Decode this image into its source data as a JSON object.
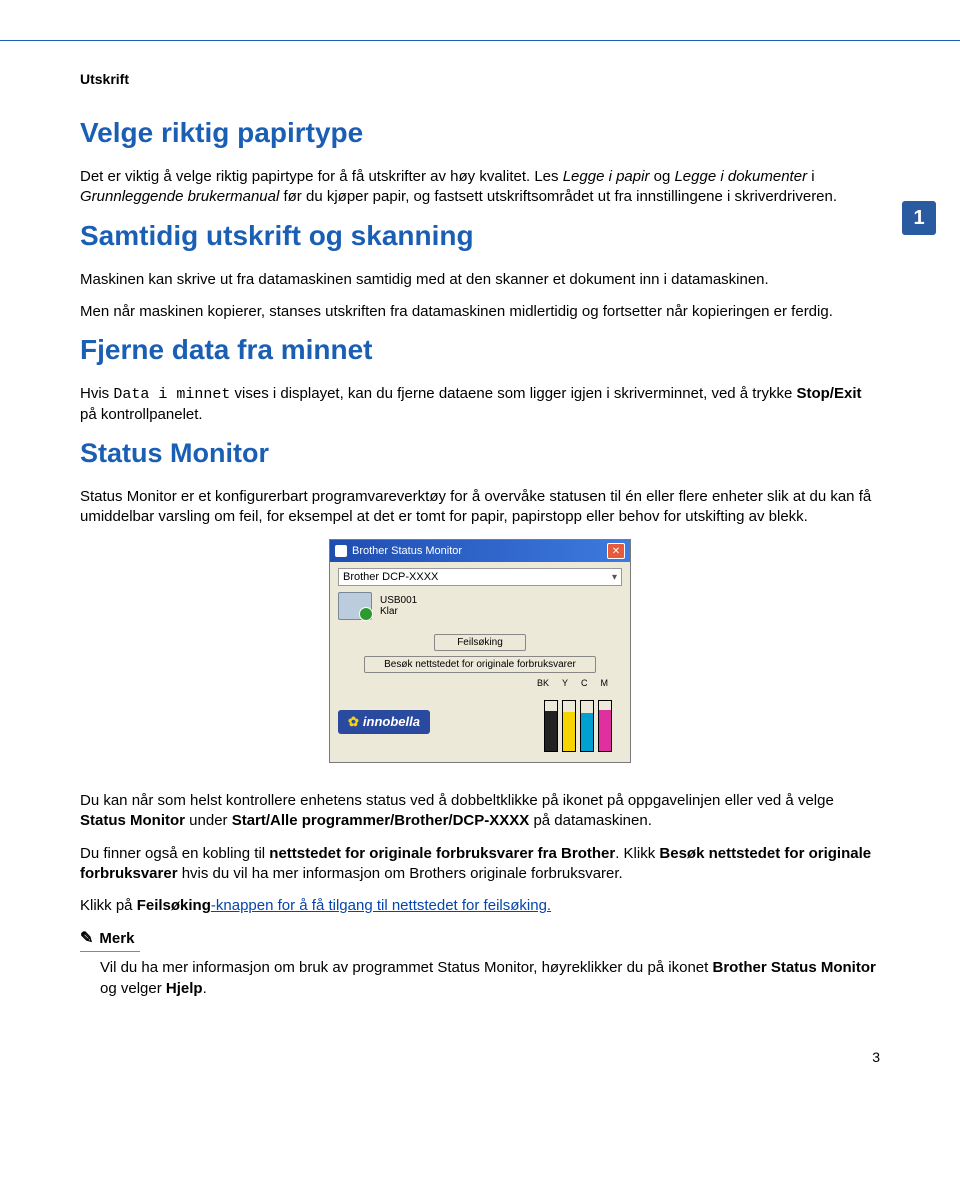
{
  "chapter_label": "Utskrift",
  "side_chapter_number": "1",
  "page_number": "3",
  "section1": {
    "heading": "Velge riktig papirtype",
    "p1a": "Det er viktig å velge riktig papirtype for å få utskrifter av høy kvalitet. Les ",
    "p1b": "Legge i papir",
    "p1c": " og ",
    "p1d": "Legge i dokumenter",
    "p1e": " i ",
    "p1f": "Grunnleggende brukermanual",
    "p1g": " før du kjøper papir, og fastsett utskriftsområdet ut fra innstillingene i skriverdriveren."
  },
  "section2": {
    "heading": "Samtidig utskrift og skanning",
    "p1": "Maskinen kan skrive ut fra datamaskinen samtidig med at den skanner et dokument inn i datamaskinen.",
    "p2": "Men når maskinen kopierer, stanses utskriften fra datamaskinen midlertidig og fortsetter når kopieringen er ferdig."
  },
  "section3": {
    "heading": "Fjerne data fra minnet",
    "p1a": "Hvis ",
    "p1b": "Data i minnet",
    "p1c": " vises i displayet, kan du fjerne dataene som ligger igjen i skriverminnet, ved å trykke ",
    "p1d": "Stop/Exit",
    "p1e": " på kontrollpanelet."
  },
  "section4": {
    "heading": "Status Monitor",
    "p1": "Status Monitor er et konfigurerbart programvareverktøy for å overvåke statusen til én eller flere enheter slik at du kan få umiddelbar varsling om feil, for eksempel at det er tomt for papir, papirstopp eller behov for utskifting av blekk.",
    "p2a": "Du kan når som helst kontrollere enhetens status ved å dobbeltklikke på ikonet på oppgavelinjen eller ved å velge ",
    "p2b": "Status Monitor",
    "p2c": " under ",
    "p2d": "Start/Alle programmer/Brother/DCP-XXXX",
    "p2e": " på datamaskinen.",
    "p3a": "Du finner også en kobling til ",
    "p3b": "nettstedet for originale forbruksvarer fra Brother",
    "p3c": ". Klikk ",
    "p3d": "Besøk nettstedet for originale forbruksvarer",
    "p3e": " hvis du vil ha mer informasjon om Brothers originale forbruksvarer.",
    "p4a": "Klikk på ",
    "p4b": "Feilsøking",
    "p4c": "-knappen for å få tilgang til nettstedet for feilsøking."
  },
  "note": {
    "label": "Merk",
    "body_a": "Vil du ha mer informasjon om bruk av programmet Status Monitor, høyreklikker du på ikonet ",
    "body_b": "Brother Status Monitor",
    "body_c": " og velger ",
    "body_d": "Hjelp",
    "body_e": "."
  },
  "screenshot": {
    "title": "Brother Status Monitor",
    "device": "Brother DCP-XXXX",
    "port": "USB001",
    "status": "Klar",
    "btn1": "Feilsøking",
    "btn2": "Besøk nettstedet for originale forbruksvarer",
    "ink_labels": [
      "BK",
      "Y",
      "C",
      "M"
    ],
    "logo": "innobella"
  }
}
